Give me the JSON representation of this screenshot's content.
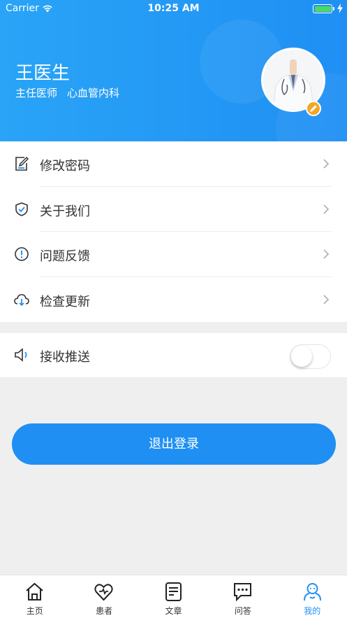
{
  "status_bar": {
    "carrier": "Carrier",
    "time": "10:25 AM"
  },
  "profile": {
    "name": "王医生",
    "title": "主任医师",
    "department": "心血管内科"
  },
  "menu": [
    {
      "label": "修改密码",
      "icon": "edit-icon"
    },
    {
      "label": "关于我们",
      "icon": "shield-icon"
    },
    {
      "label": "问题反馈",
      "icon": "alert-icon"
    },
    {
      "label": "检查更新",
      "icon": "cloud-download-icon"
    }
  ],
  "push": {
    "label": "接收推送",
    "icon": "speaker-icon",
    "enabled": false
  },
  "logout_label": "退出登录",
  "tabs": [
    {
      "label": "主页",
      "icon": "home-icon"
    },
    {
      "label": "患者",
      "icon": "heart-icon"
    },
    {
      "label": "文章",
      "icon": "article-icon"
    },
    {
      "label": "问答",
      "icon": "chat-icon"
    },
    {
      "label": "我的",
      "icon": "profile-icon",
      "active": true
    }
  ],
  "colors": {
    "primary": "#1f8ff4",
    "header_start": "#29a4f6",
    "badge": "#f5a623",
    "battery": "#4cd964"
  }
}
